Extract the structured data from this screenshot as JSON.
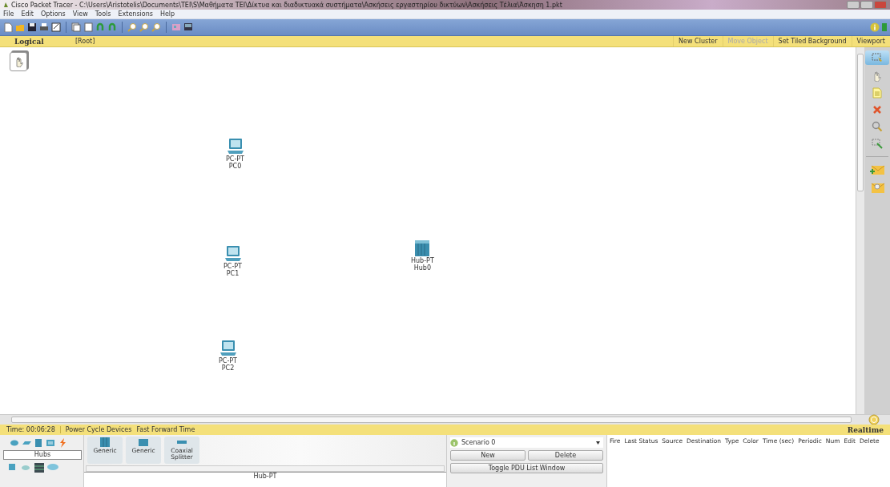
{
  "window": {
    "title": "Cisco Packet Tracer - C:\\Users\\Aristotelis\\Documents\\TEI\\S\\Μαθήματα ΤΕΙ\\Δίκτυα και διαδικτυακά συστήματα\\Ασκήσεις εργαστηρίου δικτύων\\Ασκήσεις Τέλια\\Άσκηση 1.pkt"
  },
  "menu": [
    "File",
    "Edit",
    "Options",
    "View",
    "Tools",
    "Extensions",
    "Help"
  ],
  "workspace_bar": {
    "mode": "Logical",
    "path": "[Root]",
    "actions": [
      {
        "label": "New Cluster",
        "disabled": false
      },
      {
        "label": "Move Object",
        "disabled": true
      },
      {
        "label": "Set Tiled Background",
        "disabled": false
      },
      {
        "label": "Viewport",
        "disabled": false
      }
    ]
  },
  "devices": [
    {
      "kind": "pc",
      "model": "PC-PT",
      "name": "PC0"
    },
    {
      "kind": "pc",
      "model": "PC-PT",
      "name": "PC1"
    },
    {
      "kind": "hub",
      "model": "Hub-PT",
      "name": "Hub0"
    },
    {
      "kind": "pc",
      "model": "PC-PT",
      "name": "PC2"
    }
  ],
  "time_bar": {
    "time": "Time: 00:06:28",
    "actions": [
      "Power Cycle Devices",
      "Fast Forward Time"
    ],
    "mode": "Realtime"
  },
  "device_panel": {
    "category": "Hubs",
    "models": [
      {
        "kind": "hub",
        "label": "Generic"
      },
      {
        "kind": "repeater",
        "label": "Generic"
      },
      {
        "kind": "splitter",
        "label": "Coaxial Splitter"
      }
    ],
    "selected_model": "Hub-PT"
  },
  "scenario": {
    "name": "Scenario 0",
    "buttons": [
      "New",
      "Delete"
    ],
    "toggle": "Toggle PDU List Window"
  },
  "pdu_columns": [
    "Fire",
    "Last Status",
    "Source",
    "Destination",
    "Type",
    "Color",
    "Time (sec)",
    "Periodic",
    "Num",
    "Edit",
    "Delete"
  ]
}
